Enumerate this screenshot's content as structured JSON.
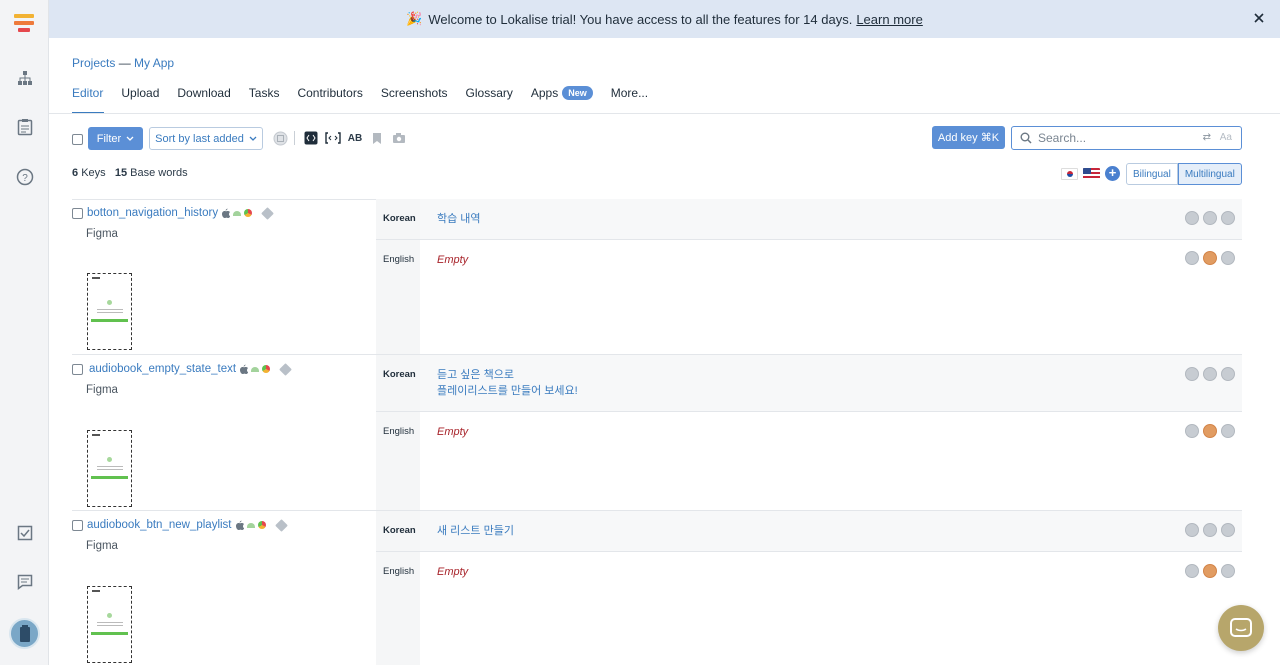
{
  "banner": {
    "emoji": "🎉",
    "text": "Welcome to Lokalise trial! You have access to all the features for 14 days.",
    "link": "Learn more"
  },
  "breadcrumb": {
    "projects": "Projects",
    "sep": "—",
    "project": "My App"
  },
  "tabs": [
    {
      "label": "Editor",
      "active": true
    },
    {
      "label": "Upload"
    },
    {
      "label": "Download"
    },
    {
      "label": "Tasks"
    },
    {
      "label": "Contributors"
    },
    {
      "label": "Screenshots"
    },
    {
      "label": "Glossary"
    },
    {
      "label": "Apps",
      "badge": "New"
    },
    {
      "label": "More..."
    }
  ],
  "toolbar": {
    "filter": "Filter",
    "sort": "Sort by last added",
    "add_key": "Add key ⌘K",
    "search_placeholder": "Search...",
    "aa": "Aa"
  },
  "counts": {
    "keys_num": "6",
    "keys_label": "Keys",
    "words_num": "15",
    "words_label": "Base words"
  },
  "view_modes": [
    "Bilingual",
    "Multilingual"
  ],
  "keys": [
    {
      "name": "botton_navigation_history",
      "source": "Figma",
      "korean_label": "Korean",
      "korean": "학습 내역",
      "english_label": "English",
      "english": "Empty"
    },
    {
      "name": "audiobook_empty_state_text",
      "source": "Figma",
      "korean_label": "Korean",
      "korean": "듣고 싶은 책으로",
      "korean2": "플레이리스트를 만들어 보세요!",
      "english_label": "English",
      "english": "Empty"
    },
    {
      "name": "audiobook_btn_new_playlist",
      "source": "Figma",
      "korean_label": "Korean",
      "korean": "새 리스트 만들기",
      "english_label": "English",
      "english": "Empty"
    }
  ],
  "colors": {
    "accent": "#5b8fd6",
    "link": "#3a7bbf",
    "empty": "#a8232a",
    "banner": "#dde6f3"
  }
}
